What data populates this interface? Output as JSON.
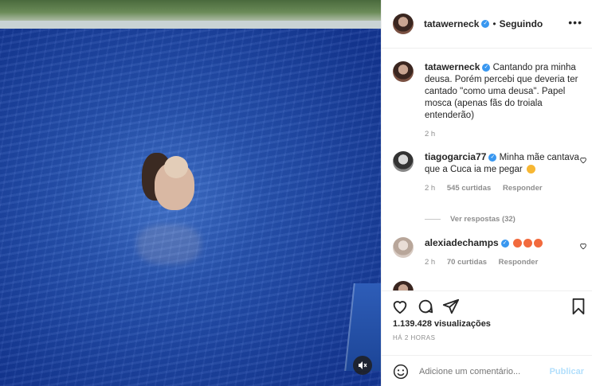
{
  "post": {
    "author": "tatawerneck",
    "follow_status": "Seguindo",
    "separator": "•",
    "more_label": "•••",
    "caption": "Cantando pra minha deusa. Porém percebi que deveria ter cantado \"como uma deusa\". Papel mosca (apenas fãs do troiala entenderão)",
    "caption_time": "2 h"
  },
  "comments": [
    {
      "user": "tiagogarcia77",
      "text": "Minha mãe cantava que a Cuca ia me pegar",
      "time": "2 h",
      "likes": "545 curtidas",
      "reply": "Responder",
      "view_replies": "Ver respostas (32)"
    },
    {
      "user": "alexiadechamps",
      "text": "",
      "time": "2 h",
      "likes": "70 curtidas",
      "reply": "Responder"
    },
    {
      "user": "",
      "text": "",
      "partial": true
    }
  ],
  "stats": {
    "views": "1.139.428 visualizações",
    "posted": "HÁ 2 HORAS"
  },
  "comment_box": {
    "placeholder": "Adicione um comentário...",
    "submit": "Publicar"
  },
  "icons": [
    "verified-badge-icon",
    "more-options-icon",
    "heart-icon",
    "comment-icon",
    "share-icon",
    "bookmark-icon",
    "emoji-icon",
    "mute-icon",
    "grin-sweat-emoji",
    "heart-eyes-emoji"
  ],
  "colors": {
    "accent": "#3897f0",
    "link_disabled": "#b2dffc",
    "muted": "#8e8e8e"
  }
}
